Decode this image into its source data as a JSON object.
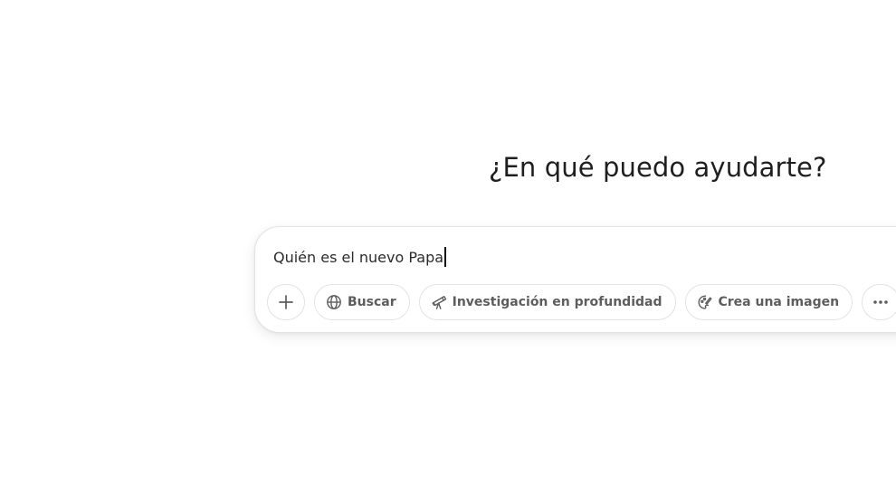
{
  "main": {
    "heading": "¿En qué puedo ayudarte?"
  },
  "composer": {
    "input_value": "Quién es el nuevo Papa",
    "tools": {
      "add_icon": "plus-icon",
      "search_label": "Buscar",
      "search_icon": "globe-icon",
      "research_label": "Investigación en profundidad",
      "research_icon": "telescope-icon",
      "image_label": "Crea una imagen",
      "image_icon": "palette-icon",
      "more_icon": "more-horizontal-icon"
    }
  },
  "colors": {
    "background": "#ffffff",
    "text": "#1f1f1f",
    "pill_border": "#e3e3e3",
    "pill_text": "#5d5d5d"
  }
}
